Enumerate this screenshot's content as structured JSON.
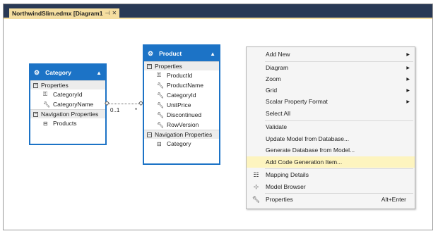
{
  "window": {
    "tab_title": "NorthwindSlim.edmx [Diagram1",
    "pin_icon": "pin-icon",
    "close_icon": "close-icon"
  },
  "entities": {
    "category": {
      "name": "Category",
      "properties_header": "Properties",
      "properties": [
        "CategoryId",
        "CategoryName"
      ],
      "nav_header": "Navigation Properties",
      "nav_properties": [
        "Products"
      ]
    },
    "product": {
      "name": "Product",
      "properties_header": "Properties",
      "properties": [
        "ProductId",
        "ProductName",
        "CategoryId",
        "UnitPrice",
        "Discontinued",
        "RowVersion"
      ],
      "nav_header": "Navigation Properties",
      "nav_properties": [
        "Category"
      ]
    }
  },
  "association": {
    "left_multiplicity": "0..1",
    "right_multiplicity": "*"
  },
  "context_menu": {
    "items": [
      {
        "label": "Add New",
        "submenu": true
      },
      {
        "label": "Diagram",
        "submenu": true
      },
      {
        "label": "Zoom",
        "submenu": true
      },
      {
        "label": "Grid",
        "submenu": true
      },
      {
        "label": "Scalar Property Format",
        "submenu": true
      },
      {
        "label": "Select All"
      },
      {
        "label": "Validate"
      },
      {
        "label": "Update Model from Database..."
      },
      {
        "label": "Generate Database from Model..."
      },
      {
        "label": "Add Code Generation Item...",
        "highlighted": true
      },
      {
        "label": "Mapping Details",
        "icon": "mapping-icon"
      },
      {
        "label": "Model Browser",
        "icon": "tree-icon"
      },
      {
        "label": "Properties",
        "icon": "wrench-icon",
        "shortcut": "Alt+Enter"
      }
    ]
  },
  "colors": {
    "entity_blue": "#1c73c6",
    "title_bar": "#293955",
    "tab_gold": "#f5dea0",
    "menu_highlight": "#fdf4bf"
  }
}
